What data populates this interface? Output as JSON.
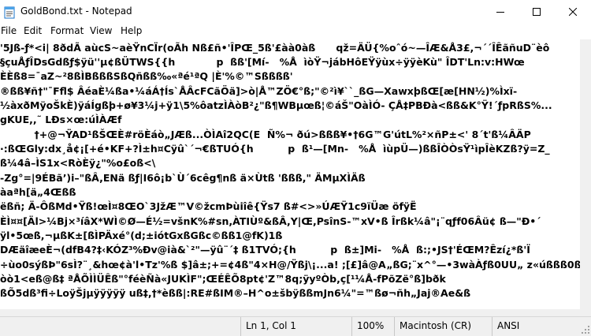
{
  "window": {
    "title": "GoldBond.txt - Notepad",
    "icon": "notepad-icon",
    "controls": [
      "minimize-icon",
      "maximize-icon",
      "close-icon"
    ]
  },
  "menu": {
    "items": [
      "File",
      "Edit",
      "Format",
      "View",
      "Help"
    ]
  },
  "editor": {
    "lines": [
      "'5Jß-ƒ*<i| 8ðdÃ aùcS~aèŸnCÏr(oÃh Nß£ñ•'ÎPŒ_5ß'£àà0àß      qž=ÄÜ{%oˆó~—ÎÆ&Å3£,¬´´ÎÊãñuD¨èô",
      "§çuÅƒÎDsGdßƒ$ÿü''µ¢ßÜTWS{{h            p  ßß'[Mí-   %Å  ìòŸ¬jábHôEŸÿùx÷ÿÿèKù\" ÎDT'Ln:v:HWœ",
      "ÈÈß8=¯aZ~²8ßÌBßßßSßQñßß‰«ªé¹ªQ |È'%©™Sßßßß'",
      "®ßß¥ñ†\"¯Ffl$ ÂéaÈ¼ßa•¼áÁ†Ís`ÅÂcFCãÖä]>ò|Å™ZÖ€°ß;\"©²ì¥``_ßG—XawxþßŒ[æ[HN½)%Ìxï-",
      "½àxðMÿoŠkÈ)ÿáÍgßþ+ø¥3¼j+ÿ1\\5%ôatzÌÀòB²¿\"ß¶WBµœß¦©áŠ\"OàÌÓ- ÇÅ‡PBÐà<ßß&K°Ÿ!´ƒpRßS%...",
      "gKUE,,˜ LÐs×œ:úÌÀÆf",
      "          †+@¬ŸAD¹ßŠŒÈ#röÈáò„JÆß...ÒÌAî2QC(E  Ñ%¬ ðú>ßßß¥•†6G™G'útL%²×ñP±<' 8´t'ß¼ÂÄP",
      "·:ßŒGly:dx¸å¢¡[+é•KF+?Ì±h¤Cÿû`´¬€ßTUÓ{h          p  ß¹—[Mn-   %Å  ìùpÜ—)ßßÎÒÒsŸ¹ìpÎèKZß?ÿ=Z_",
      "ß¼4â–ÌS1x<RòÈÿ¿\"%o£oß<\\",
      "-Zg°=|9ÉBã’)i–\"ßÂ,ENä ßƒ|I6ô¡b`Ù´6cêg¶nß ä×Ùtß 'ßßß,\" ÄMµXÌÄß",
      "àaªh[ä„4Œßß",
      "ëßñ; Ä-ÔßMd•Ÿß!œÌ¤8ŒO`3JžÆ™V©žcmÞùiîê{Ÿs7 ß#<>»ÚÆŸ1c9ïÜæ öfÿË",
      "ÈÌ¤¤[Äl>¼Bj×³íâX*WÌ©Ø—É½=všnK%#sn,ÀTIÙº&ßÂ,Y|Œ,PsînS-™xV•ß Îrßk¼â\"¡¨qƒf06Âü¢ ß—\"Ð•´",
      "ÿl•5œß,¬µßK±[ßÌPÄxé°(d;±iótGxßGßc©ßß1@fK)1ß",
      "DÆäîæeÈ¬(dfB4?‡‹KÓZ³%Ðv@ià&`²\"—ÿû¨´‡ ß1TVÓ;{h          p  ß±]Mi-   %Å  ß:;•JS†'ÉŒM?Êzí¿*ß'Ï",
      "÷ùo0sýßÞ\"6sÌ?¨¸&hœ¢à'l•Tz'%ß $]â±;+=¢4ß\"4×H@/Ÿßj\\¡...a! ;[£]â@A„ßG;¨x^°—•3wàÀƒß0UU„ z«úßßß0ß",
      "òò1<eß@ß‡ ªÅÕÌÌÜÊß\"°féèÑà«JUKÌF\";ŒÉÊÕ8pt¢'Z™8q;ÿyºÒb,ç[¹¼Å-fPõZë°ß]bðk",
      "ßÕ5dß³fi÷LoÿŠjµÿÿÿÿÿ uß‡,†*èßß|:RE#ßIM®–H^o±šbÿßßmJn6¼\"=™ßø¬ñh„Jaj®Ae&ß"
    ]
  },
  "status": {
    "position": "Ln 1, Col 1",
    "zoom": "100%",
    "line_ending": "Macintosh (CR)",
    "encoding": "ANSI"
  }
}
